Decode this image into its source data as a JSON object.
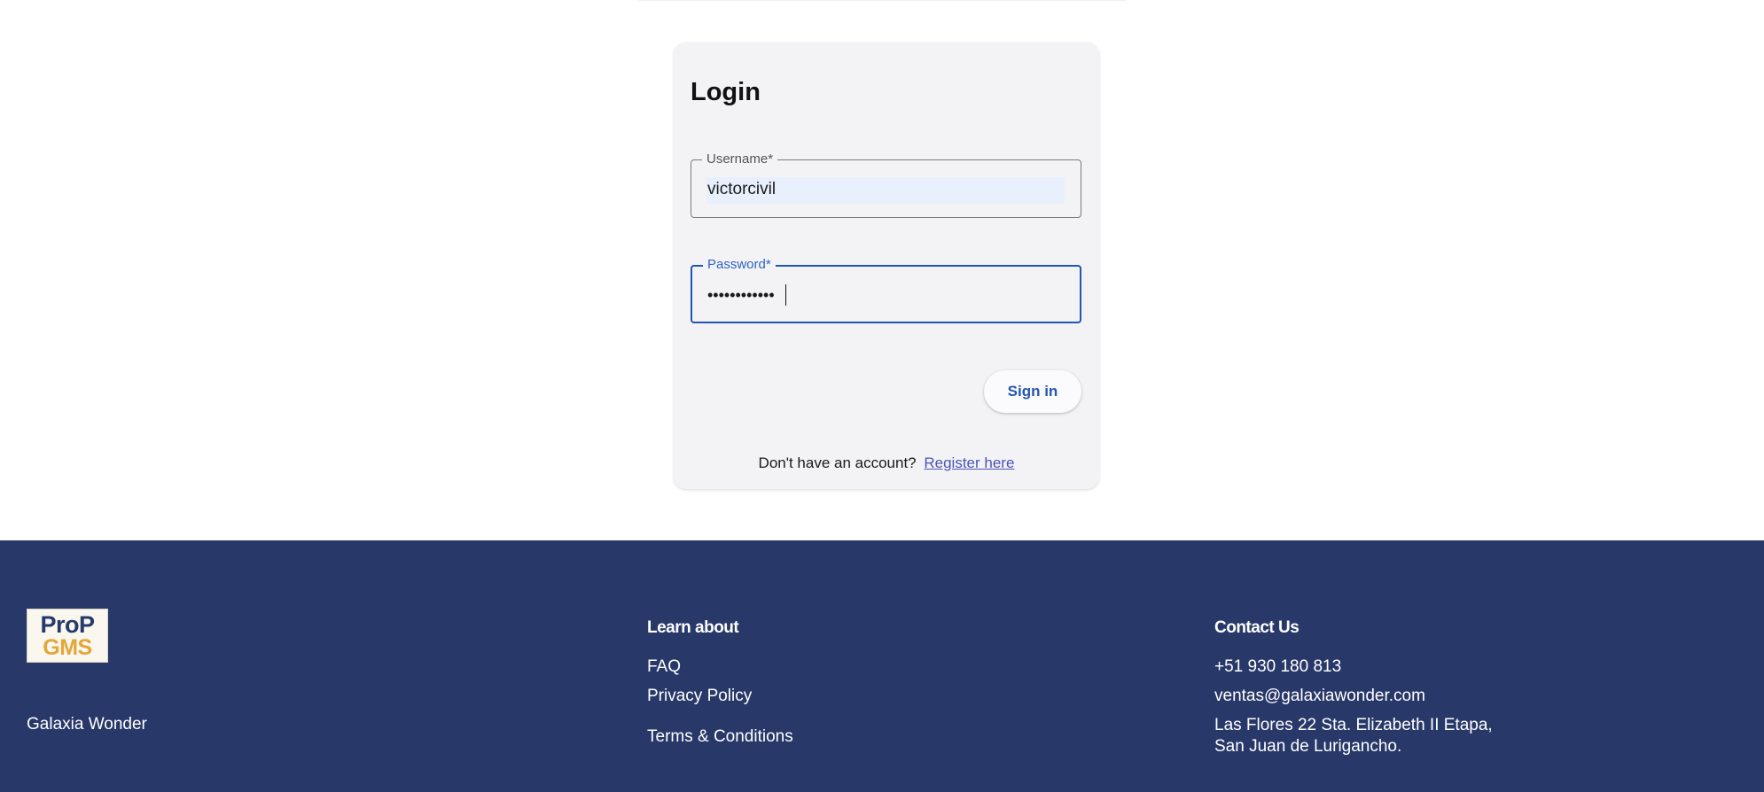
{
  "login": {
    "title": "Login",
    "username": {
      "label": "Username*",
      "value": "victorcivil"
    },
    "password": {
      "label": "Password*",
      "value": "••••••••••••"
    },
    "signin_label": "Sign in",
    "register_prompt": "Don't have an account?",
    "register_link": "Register here"
  },
  "footer": {
    "logo": {
      "line1": "ProP",
      "line2": "GMS"
    },
    "company_name": "Galaxia Wonder",
    "learn": {
      "title": "Learn about",
      "links": [
        "FAQ",
        "Privacy Policy",
        "Terms & Conditions"
      ]
    },
    "contact": {
      "title": "Contact Us",
      "phone": "+51 930 180 813",
      "email": "ventas@galaxiawonder.com",
      "address_line1": "Las Flores 22 Sta. Elizabeth II Etapa,",
      "address_line2": "San Juan de Lurigancho."
    }
  },
  "colors": {
    "footer_bg": "#283869",
    "primary": "#1f56b3",
    "card_bg": "#f3f3f6",
    "logo_gold": "#e3a739"
  }
}
